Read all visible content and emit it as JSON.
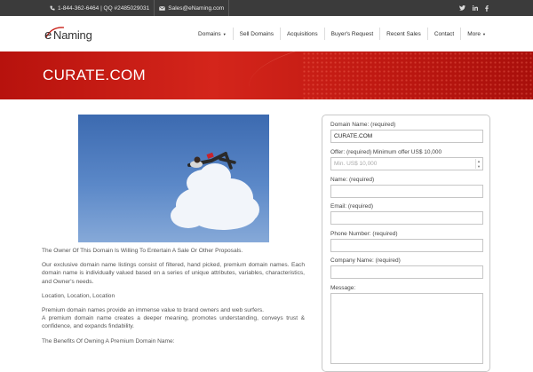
{
  "topbar": {
    "phone": "1-844-362-6464 | QQ #2485029031",
    "email": "Sales@eNaming.com",
    "social_icons": [
      "twitter-icon",
      "linkedin-icon",
      "facebook-icon"
    ]
  },
  "header": {
    "logo_e": "e",
    "logo_rest": "Naming",
    "nav": [
      {
        "label": "Domains",
        "dropdown": true
      },
      {
        "label": "Sell Domains",
        "dropdown": false
      },
      {
        "label": "Acquisitions",
        "dropdown": false
      },
      {
        "label": "Buyer's Request",
        "dropdown": false
      },
      {
        "label": "Recent Sales",
        "dropdown": false
      },
      {
        "label": "Contact",
        "dropdown": false
      },
      {
        "label": "More",
        "dropdown": true
      }
    ]
  },
  "banner": {
    "title": "CURATE.COM"
  },
  "main": {
    "paragraphs": [
      "The Owner Of This Domain Is Willing To Entertain A Sale Or Other Proposals.",
      "Our exclusive domain name listings consist of filtered, hand picked, premium domain names. Each domain name is individually valued based on a series of unique attributes, variables, characteristics, and Owner's needs.",
      "Location, Location, Location",
      "Premium domain names provide an immense value to brand owners and web surfers.",
      "A premium domain name creates a deeper meaning, promotes understanding, conveys trust & confidence, and expands findability.",
      "The Benefits Of Owning A Premium Domain Name:"
    ]
  },
  "form": {
    "domain_label": "Domain Name: (required)",
    "domain_value": "CURATE.COM",
    "offer_label": "Offer: (required) Minimum offer US$ 10,000",
    "offer_placeholder": "Min. US$ 10,000",
    "name_label": "Name: (required)",
    "email_label": "Email: (required)",
    "phone_label": "Phone Number: (required)",
    "company_label": "Company Name: (required)",
    "message_label": "Message:"
  },
  "colors": {
    "banner_red": "#c81c14",
    "topbar_dark": "#3b3b3b",
    "sky_blue": "#4a78bd"
  }
}
